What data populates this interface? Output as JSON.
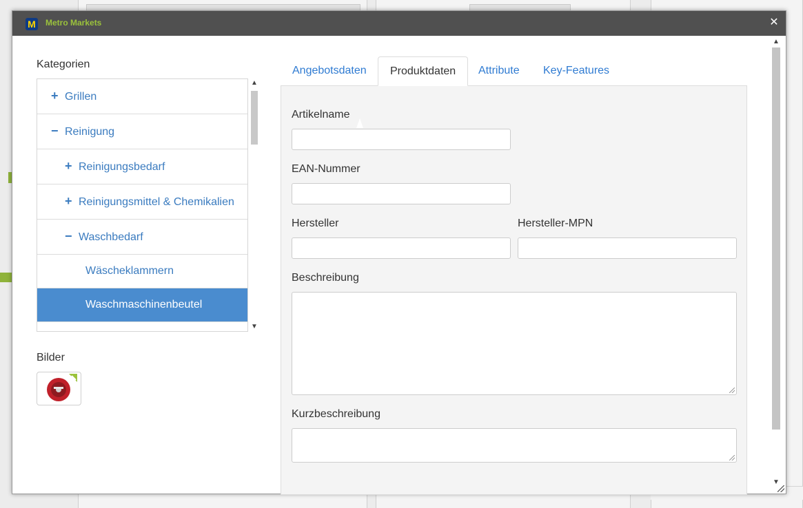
{
  "window": {
    "title": "Metro Markets",
    "logo_letter": "M"
  },
  "left": {
    "categories_label": "Kategorien",
    "categories": [
      {
        "sign": "+",
        "label": "Grillen",
        "level": 0,
        "active": false
      },
      {
        "sign": "−",
        "label": "Reinigung",
        "level": 0,
        "active": false
      },
      {
        "sign": "+",
        "label": "Reinigungsbedarf",
        "level": 1,
        "active": false
      },
      {
        "sign": "+",
        "label": "Reinigungsmittel & Chemikalien",
        "level": 1,
        "active": false
      },
      {
        "sign": "−",
        "label": "Waschbedarf",
        "level": 1,
        "active": false
      },
      {
        "sign": "",
        "label": "Wäscheklammern",
        "level": 2,
        "active": false
      },
      {
        "sign": "",
        "label": "Waschmaschinenbeutel",
        "level": 2,
        "active": true
      }
    ],
    "images_label": "Bilder"
  },
  "tabs": [
    {
      "label": "Angebotsdaten",
      "active": false
    },
    {
      "label": "Produktdaten",
      "active": true
    },
    {
      "label": "Attribute",
      "active": false
    },
    {
      "label": "Key-Features",
      "active": false
    }
  ],
  "form": {
    "article_name_label": "Artikelname",
    "article_name_value": "",
    "ean_label": "EAN-Nummer",
    "ean_value": "",
    "manufacturer_label": "Hersteller",
    "manufacturer_value": "",
    "mpn_label": "Hersteller-MPN",
    "mpn_value": "",
    "description_label": "Beschreibung",
    "description_value": "",
    "short_description_label": "Kurzbeschreibung",
    "short_description_value": ""
  },
  "colors": {
    "titlebar": "#505050",
    "title_text": "#9bc23c",
    "link": "#3a7bbf",
    "active_item": "#4a8ccf"
  },
  "icons": {
    "close": "close-icon",
    "plus": "plus-icon",
    "minus": "minus-icon",
    "scroll_up": "chevron-up-icon",
    "scroll_down": "chevron-down-icon"
  }
}
